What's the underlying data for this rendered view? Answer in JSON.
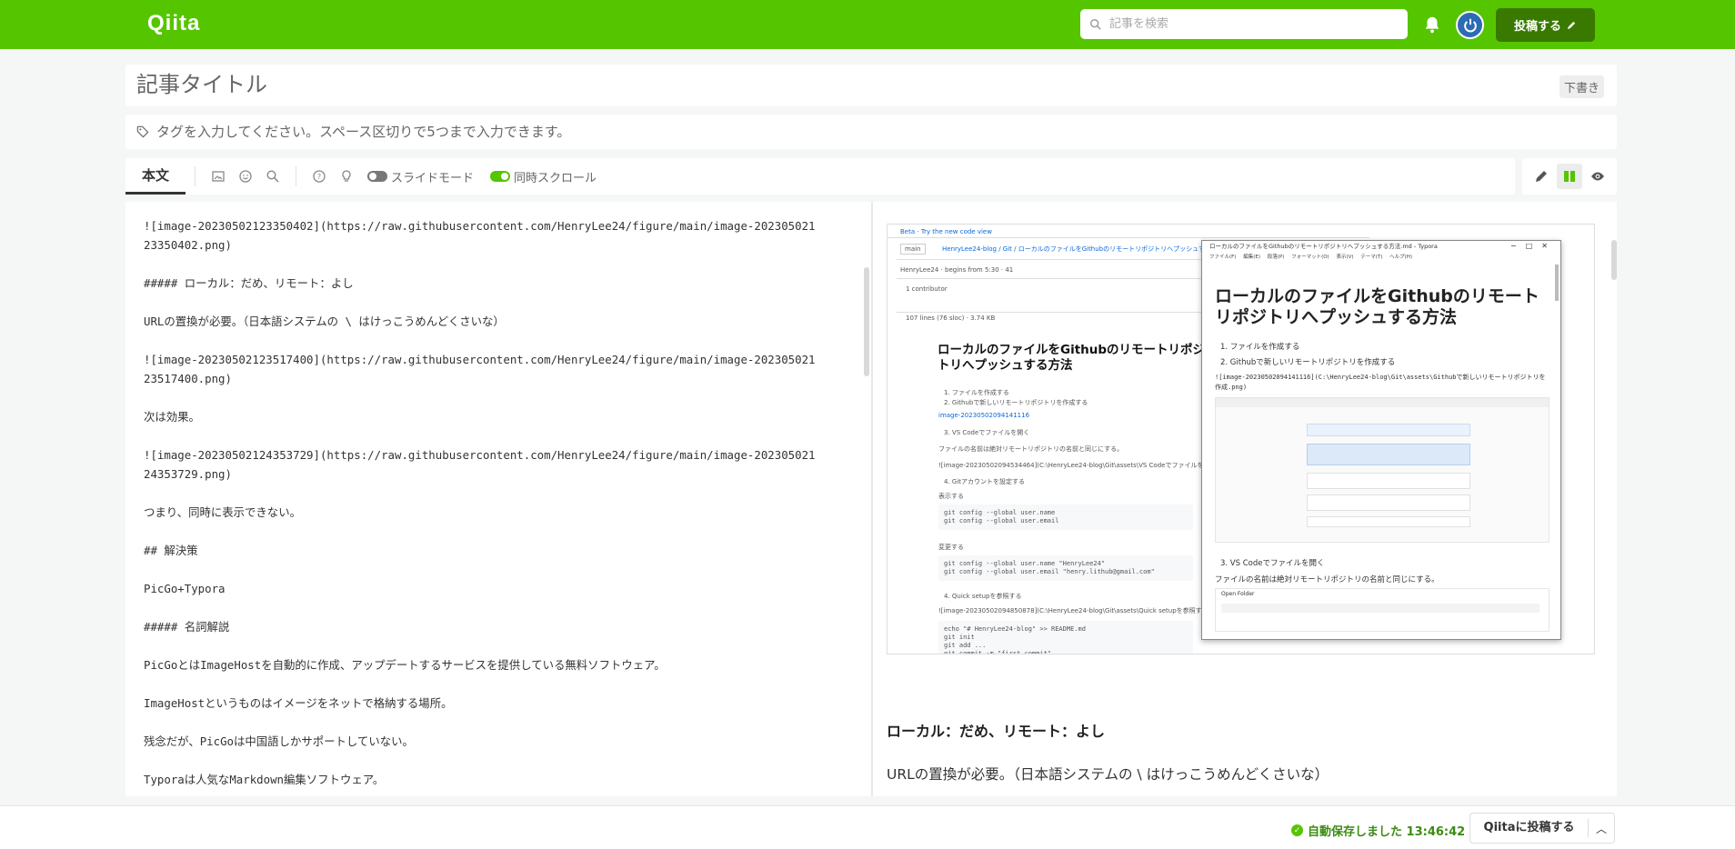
{
  "header": {
    "logo": "Qiita",
    "search_placeholder": "記事を検索",
    "post_button": "投稿する"
  },
  "title": {
    "placeholder": "記事タイトル",
    "draft_badge": "下書き"
  },
  "tags": {
    "placeholder": "タグを入力してください。スペース区切りで5つまで入力できます。"
  },
  "toolbar": {
    "body_tab": "本文",
    "slide_mode_label": "スライドモード",
    "sync_scroll_label": "同時スクロール",
    "icons": [
      "image-icon",
      "emoji-icon",
      "search-icon",
      "help-icon",
      "bulb-icon"
    ]
  },
  "editor": {
    "lines": [
      "![image-20230502123350402](https://raw.githubusercontent.com/HenryLee24/figure/main/image-20230502123350402.png)",
      "##### ローカル：だめ、リモート：よし",
      "URLの置換が必要。（日本語システムの \\ はけっこうめんどくさいな）",
      "![image-20230502123517400](https://raw.githubusercontent.com/HenryLee24/figure/main/image-20230502123517400.png)",
      "次は効果。",
      "![image-20230502124353729](https://raw.githubusercontent.com/HenryLee24/figure/main/image-20230502124353729.png)",
      "つまり、同時に表示できない。",
      "## 解決策",
      "PicGo+Typora",
      "##### 名詞解説",
      "PicGoとはImageHostを自動的に作成、アップデートするサービスを提供している無料ソフトウェア。",
      "ImageHostというものはイメージをネットで格納する場所。",
      "残念だが、PicGoは中国語しかサポートしていない。",
      "Typoraは人気なMarkdown編集ソフトウェア。"
    ]
  },
  "preview": {
    "heading": "ローカル：だめ、リモート：よし",
    "paragraph": "URLの置換が必要。（日本語システムの \\ はけっこうめんどくさいな）",
    "embedded": {
      "github_title": "ローカルのファイルをGithubのリモートリポジトリへプッシュする方法",
      "breadcrumb": "HenryLee24-blog / Git / ローカルのファイルをGithubのリモートリポジトリへプッシュする方法",
      "branch": "main",
      "contributor": "1 contributor",
      "steps": [
        "1. ファイルを作成する",
        "2. Githubで新しいリモートリポジトリを作成する",
        "3. VS Codeでファイルを開く",
        "4. Gitアカウントを設定する"
      ],
      "typora_window_title": "ローカルのファイルをGithubのリモートリポジトリへプッシュする方法.md - Typora",
      "typora_menu": "ファイル(F) 編集(E) 段落(P) フォーマット(O) 表示(V) テーマ(T) ヘルプ(H)",
      "typora_heading": "ローカルのファイルをGithubのリモートリポジトリへプッシュする方法",
      "typora_step1": "1. ファイルを作成する",
      "typora_step2": "2. Githubで新しいリモートリポジトリを作成する",
      "typora_image_path": "![image-20230502094141116](C:\\HenryLee24-blog\\Git\\assets\\Githubで新しいリモートリポジトリを作成.png)",
      "typora_step3": "3. VS Codeでファイルを開く",
      "typora_note": "ファイルの名前は絶対リモートリポジトリの名前と同じにする。",
      "open_folder": "Open Folder"
    }
  },
  "footer": {
    "autosave": "自動保存しました 13:46:42",
    "submit": "Qiitaに投稿する"
  },
  "colors": {
    "brand": "#55c500",
    "post_button": "#3a7900"
  }
}
